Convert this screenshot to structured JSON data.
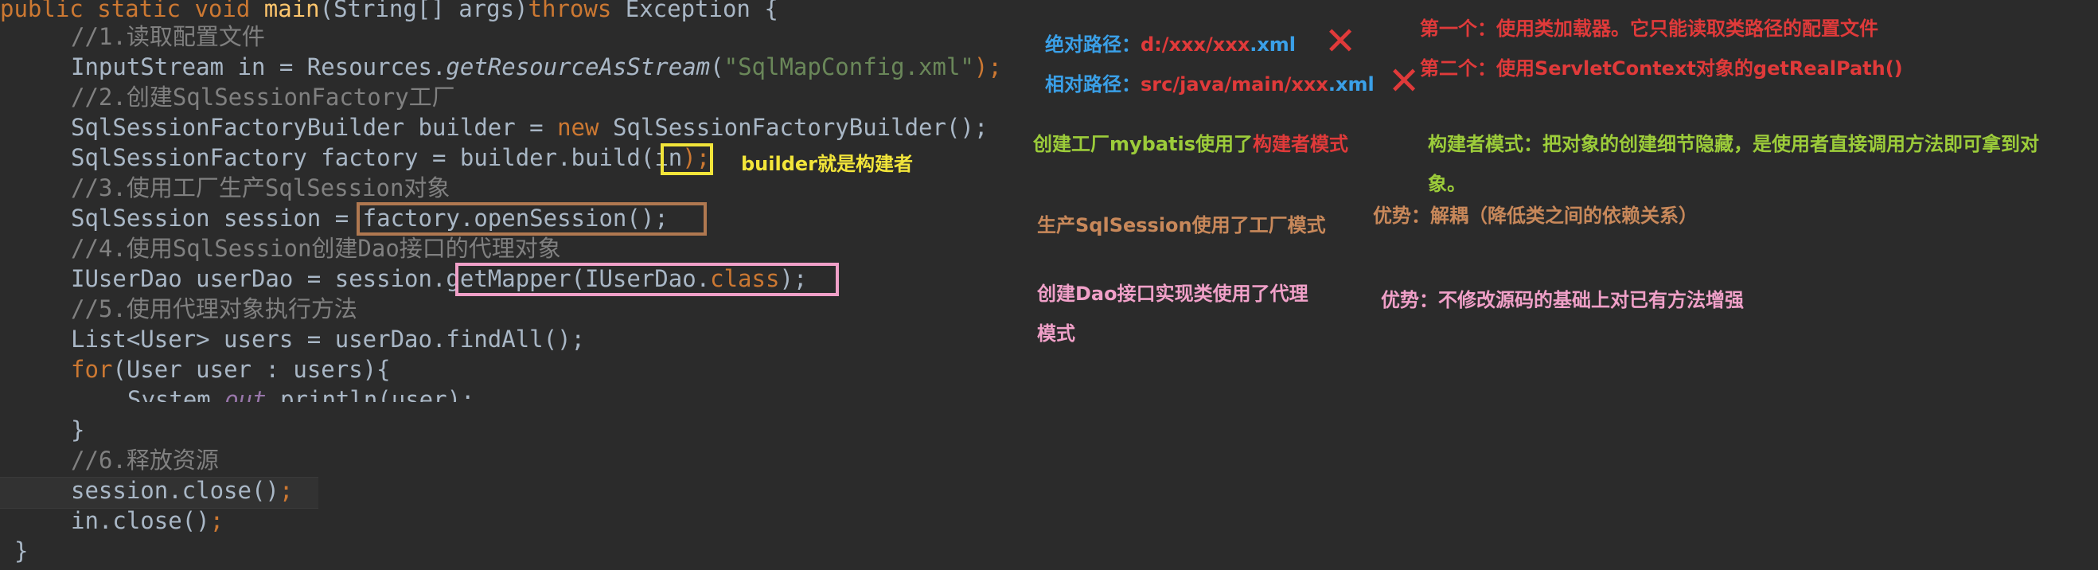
{
  "code": {
    "l0": {
      "kw1": "public",
      "kw2": "static",
      "kw3": "void",
      "fn": "main",
      "mid": "(String[] args)",
      "kw4": "throws",
      "tail": " Exception {"
    },
    "l1": "//1.读取配置文件",
    "l2": {
      "a": "InputStream in = Resources.",
      "m": "getResourceAsStream",
      "b": "(",
      "s": "\"SqlMapConfig.xml\"",
      "c": ");"
    },
    "l3": "//2.创建SqlSessionFactory工厂",
    "l4": {
      "a": "SqlSessionFactoryBuilder builder = ",
      "kw": "new",
      "b": " SqlSessionFactoryBuilder();"
    },
    "l5": {
      "a": "SqlSessionFactory factory = builder.build(",
      "b": "in",
      "c": ");"
    },
    "l6": "//3.使用工厂生产SqlSession对象",
    "l7": {
      "a": "SqlSession session = ",
      "b": "factory.openSession();"
    },
    "l8": "//4.使用SqlSession创建Dao接口的代理对象",
    "l9": {
      "a": "IUserDao userDao = session.",
      "b": "getMapper(IUserDao.",
      "kw": "class",
      "c": ");"
    },
    "l10": "//5.使用代理对象执行方法",
    "l11": "List<User> users = userDao.findAll();",
    "l12": {
      "kw": "for",
      "b": "(User user : users){"
    },
    "l13": {
      "a": "System.",
      "b": "out",
      "c": ".println(user);"
    },
    "l14": "}",
    "l15": "//6.释放资源",
    "l16": "session.close();",
    "l17": "in.close();",
    "l18": "}"
  },
  "notes": {
    "abs_label": "绝对路径：",
    "abs_value": "d:/xxx/xxx.xml",
    "rel_label": "相对路径：",
    "rel_value": "src/java/main/xxx.xml",
    "first": "第一个：使用类加载器。它只能读取类路径的配置文件",
    "second": "第二个：使用ServletContext对象的getRealPath()",
    "builder_is": "builder就是构建者",
    "factory_a": "创建工厂mybatis使用了",
    "factory_b": "构建者模式",
    "builder_desc1": "构建者模式：把对象的创建细节隐藏，是使用者直接调用方法即可拿到对",
    "builder_desc2": "象。",
    "session_factory": "生产SqlSession使用了工厂模式",
    "advantage1": "优势：解耦（降低类之间的依赖关系）",
    "proxy1": "创建Dao接口实现类使用了代理",
    "proxy2": "模式",
    "advantage2": "优势：不修改源码的基础上对已有方法增强"
  },
  "colors": {
    "red": "#e03a3a",
    "blue": "#3aa0e8",
    "yellow": "#f2e53a",
    "green": "#9ccc3a",
    "orange": "#c8885a",
    "pink": "#f0a0c8",
    "box_yellow": "#f2e53a",
    "box_brown": "#b07850",
    "box_pink": "#f0a0c8"
  }
}
